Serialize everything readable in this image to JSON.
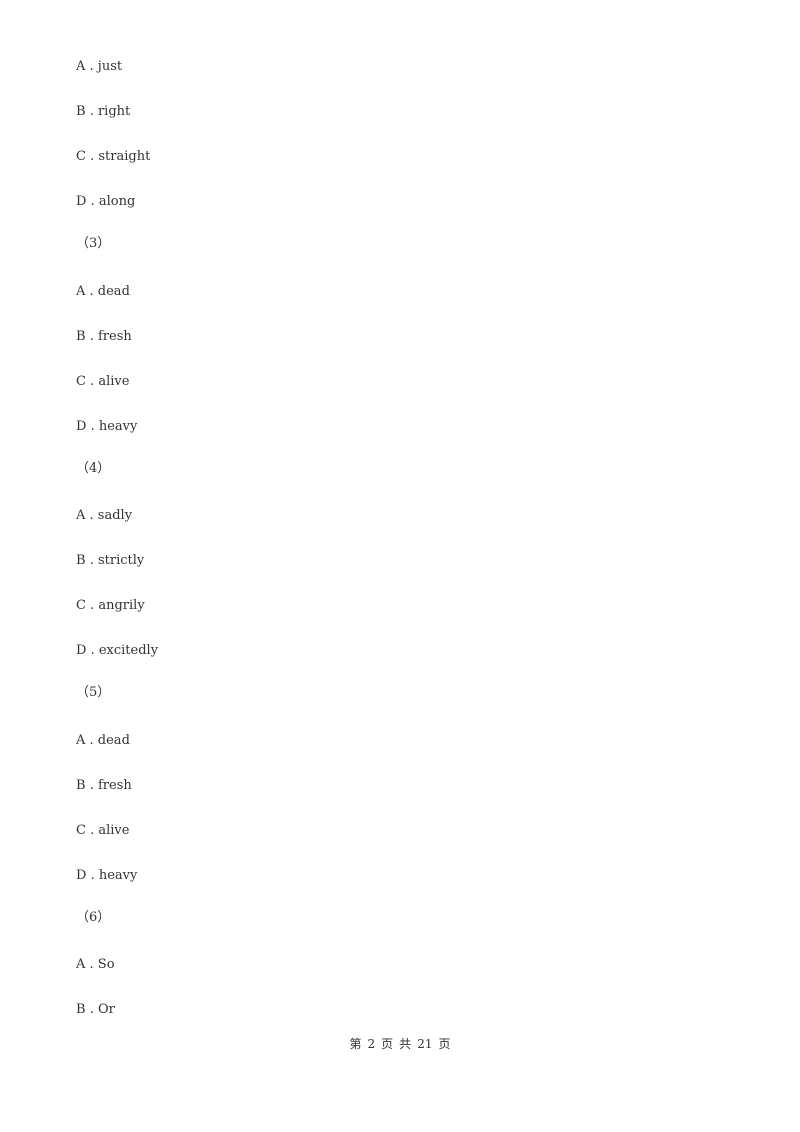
{
  "questions": [
    {
      "number": null,
      "options": [
        {
          "letter": "A",
          "text": "just"
        },
        {
          "letter": "B",
          "text": "right"
        },
        {
          "letter": "C",
          "text": "straight"
        },
        {
          "letter": "D",
          "text": "along"
        }
      ]
    },
    {
      "number": "（3）",
      "options": [
        {
          "letter": "A",
          "text": "dead"
        },
        {
          "letter": "B",
          "text": "fresh"
        },
        {
          "letter": "C",
          "text": "alive"
        },
        {
          "letter": "D",
          "text": "heavy"
        }
      ]
    },
    {
      "number": "（4）",
      "options": [
        {
          "letter": "A",
          "text": "sadly"
        },
        {
          "letter": "B",
          "text": "strictly"
        },
        {
          "letter": "C",
          "text": "angrily"
        },
        {
          "letter": "D",
          "text": "excitedly"
        }
      ]
    },
    {
      "number": "（5）",
      "options": [
        {
          "letter": "A",
          "text": "dead"
        },
        {
          "letter": "B",
          "text": "fresh"
        },
        {
          "letter": "C",
          "text": "alive"
        },
        {
          "letter": "D",
          "text": "heavy"
        }
      ]
    },
    {
      "number": "（6）",
      "options": [
        {
          "letter": "A",
          "text": "So"
        },
        {
          "letter": "B",
          "text": "Or"
        }
      ]
    }
  ],
  "separator": " . ",
  "footer": {
    "prefix": "第",
    "current_page": "2",
    "page_char": "页",
    "total_label": "共",
    "total_pages": "21",
    "suffix": "页"
  }
}
